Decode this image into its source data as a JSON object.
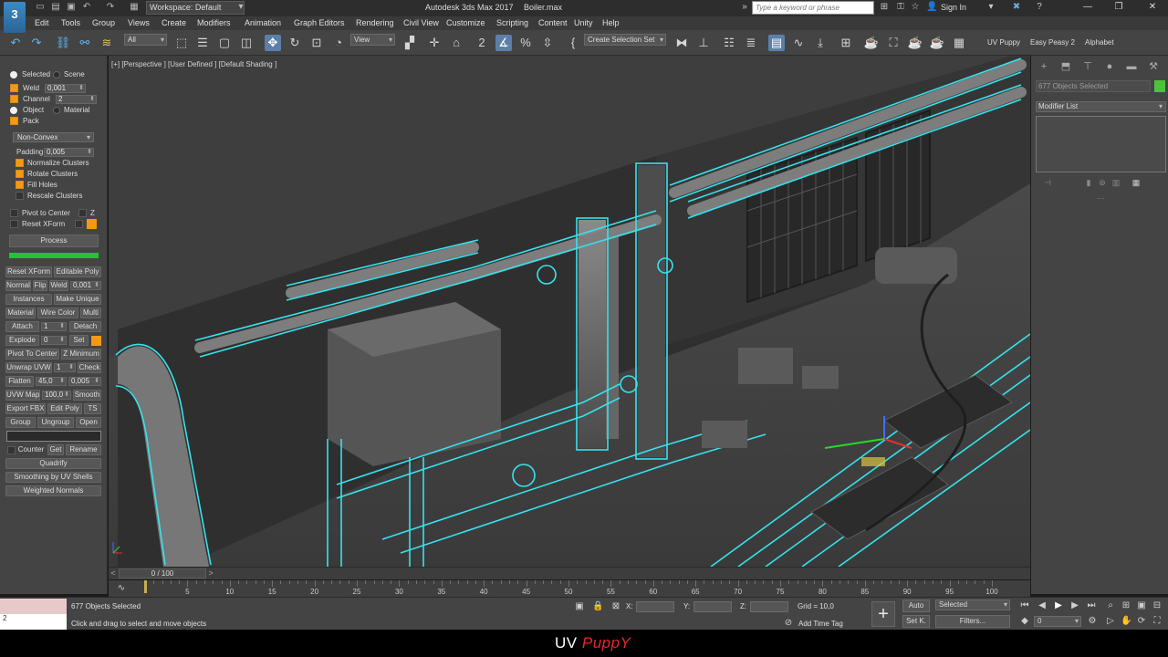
{
  "app": {
    "logo_text": "3",
    "workspace": "Workspace: Default",
    "title": "Autodesk 3ds Max 2017",
    "file": "Boiler.max",
    "search_placeholder": "Type a keyword or phrase",
    "sign_in": "Sign In"
  },
  "menu": [
    "Edit",
    "Tools",
    "Group",
    "Views",
    "Create",
    "Modifiers",
    "Animation",
    "Graph Editors",
    "Rendering",
    "Civil View",
    "Customize",
    "Scripting",
    "Content",
    "Unity",
    "Help"
  ],
  "toolbar": {
    "selection_filter": "All",
    "ref_coord": "View",
    "named_selection": "Create Selection Set",
    "plugins": [
      "UV Puppy",
      "Easy Peasy 2",
      "Alphabet"
    ]
  },
  "left_panel": {
    "selected_label": "Selected",
    "scene_label": "Scene",
    "weld_label": "Weld",
    "weld_value": "0,001",
    "channel_label": "Channel",
    "channel_value": "2",
    "object_label": "Object",
    "material_label": "Material",
    "pack_label": "Pack",
    "pack_mode": "Non-Convex",
    "padding_label": "Padding",
    "padding_value": "0,005",
    "normalize_clusters": "Normalize Clusters",
    "rotate_clusters": "Rotate Clusters",
    "fill_holes": "Fill Holes",
    "rescale_clusters": "Rescale Clusters",
    "pivot_to_center": "Pivot to Center",
    "z_label": "Z",
    "reset_xform": "Reset XForm",
    "process": "Process",
    "process_progress": 1.0,
    "reset_xform_btn": "Reset XForm",
    "editable_poly": "Editable Poly",
    "normal": "Normal",
    "flip": "Flip",
    "weld2": "Weld",
    "weld2_value": "0,001",
    "instances": "Instances",
    "make_unique": "Make Unique",
    "material_btn": "Material",
    "wire_color": "Wire Color",
    "multi": "Multi",
    "attach": "Attach",
    "attach_value": "1",
    "detach": "Detach",
    "explode": "Explode",
    "explode_value": "0",
    "set": "Set",
    "pivot_to_center_btn": "Pivot To Center",
    "z_minimum": "Z Minimum",
    "unwrap_uvw": "Unwrap UVW",
    "unwrap_value": "1",
    "check": "Check",
    "flatten": "Flatten",
    "flatten_angle": "45,0",
    "flatten_spacing": "0,005",
    "uvw_map": "UVW Map",
    "uvw_map_value": "100,0",
    "smooth": "Smooth",
    "export_fbx": "Export FBX",
    "edit_poly": "Edit Poly",
    "ts": "TS",
    "group": "Group",
    "ungroup": "Ungroup",
    "open": "Open",
    "counter": "Counter",
    "get": "Get",
    "rename": "Rename",
    "quadrify": "Quadrify",
    "smoothing_by_uv_shells": "Smoothing by UV Shells",
    "weighted_normals": "Weighted Normals"
  },
  "viewport": {
    "label": "[+] [Perspective ] [User Defined ] [Default Shading ]"
  },
  "right_panel": {
    "selection_info": "677 Objects Selected",
    "modifier_list": "Modifier List",
    "swatch_color": "#4fc23c"
  },
  "timeline": {
    "frame_display": "0 / 100",
    "current_frame": 0,
    "ticks": [
      "5",
      "10",
      "15",
      "20",
      "25",
      "30",
      "35",
      "40",
      "45",
      "50",
      "55",
      "60",
      "65",
      "70",
      "75",
      "80",
      "85",
      "90",
      "95",
      "100"
    ]
  },
  "status": {
    "maxscript_value": "2",
    "selection": "677 Objects Selected",
    "prompt": "Click and drag to select and move objects",
    "x_label": "X:",
    "y_label": "Y:",
    "z_label": "Z:",
    "grid": "Grid = 10,0",
    "add_time_tag": "Add Time Tag",
    "auto": "Auto",
    "set_key": "Set K.",
    "key_filter": "Selected",
    "filters": "Filters...",
    "frame": "0"
  },
  "brand": {
    "part1": "UV",
    "part2": "PuppY"
  }
}
